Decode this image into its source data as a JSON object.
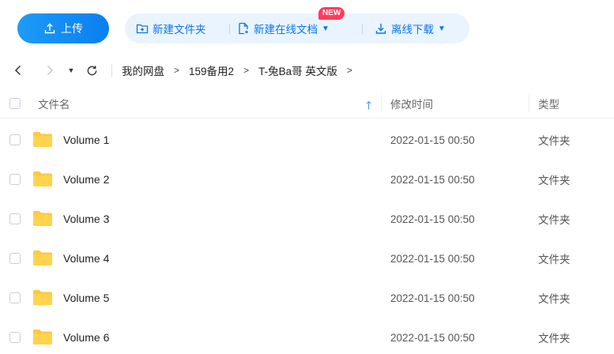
{
  "toolbar": {
    "upload_label": "上传",
    "new_folder_label": "新建文件夹",
    "new_online_doc_label": "新建在线文档",
    "new_badge": "NEW",
    "offline_download_label": "离线下载"
  },
  "breadcrumb": {
    "items": [
      "我的网盘",
      "159备用2",
      "T-兔Ba哥 英文版"
    ],
    "separator": ">"
  },
  "table": {
    "columns": {
      "name": "文件名",
      "modified": "修改时间",
      "type": "类型"
    },
    "rows": [
      {
        "name": "Volume 1",
        "modified": "2022-01-15 00:50",
        "type": "文件夹"
      },
      {
        "name": "Volume 2",
        "modified": "2022-01-15 00:50",
        "type": "文件夹"
      },
      {
        "name": "Volume 3",
        "modified": "2022-01-15 00:50",
        "type": "文件夹"
      },
      {
        "name": "Volume 4",
        "modified": "2022-01-15 00:50",
        "type": "文件夹"
      },
      {
        "name": "Volume 5",
        "modified": "2022-01-15 00:50",
        "type": "文件夹"
      },
      {
        "name": "Volume 6",
        "modified": "2022-01-15 00:50",
        "type": "文件夹"
      }
    ]
  },
  "colors": {
    "accent": "#0b77e8",
    "folder": "#ffc93c",
    "badge": "#ff3b5c"
  }
}
